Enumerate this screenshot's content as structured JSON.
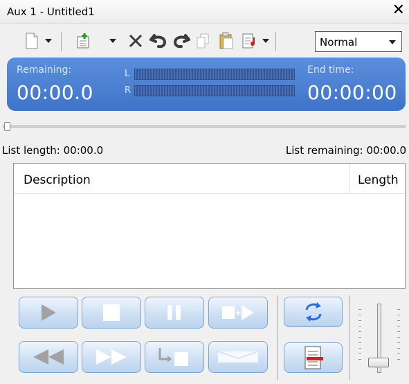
{
  "window": {
    "title": "Aux 1 - Untitled1",
    "close_glyph": "✕"
  },
  "toolbar": {
    "icons": [
      "new-document-icon",
      "add-item-icon",
      "delete-icon",
      "undo-icon",
      "redo-icon",
      "copy-icon",
      "paste-icon",
      "properties-icon"
    ],
    "mode_value": "Normal"
  },
  "status": {
    "remaining_label": "Remaining:",
    "remaining_value": "00:00.0",
    "end_label": "End time:",
    "end_value": "00:00:00",
    "left_channel": "L",
    "right_channel": "R"
  },
  "list": {
    "length_text": "List length: 00:00.0",
    "remaining_text": "List remaining: 00:00.0",
    "columns": [
      "Description",
      "Length"
    ],
    "rows": []
  },
  "transport": {
    "buttons_row1": [
      "play",
      "stop",
      "pause",
      "play-next",
      "loop"
    ],
    "buttons_row2": [
      "rewind",
      "fast-forward",
      "jump-next",
      "cue",
      "playlist"
    ]
  },
  "volume": {
    "level": 0.16
  },
  "colors": {
    "panel_blue": "#4a7fd4",
    "button_face": "#cfe0f4"
  }
}
